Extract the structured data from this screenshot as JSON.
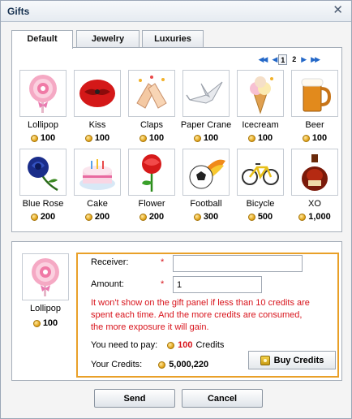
{
  "window": {
    "title": "Gifts"
  },
  "tabs": [
    {
      "label": "Default"
    },
    {
      "label": "Jewelry"
    },
    {
      "label": "Luxuries"
    }
  ],
  "pager": {
    "pages": [
      "1",
      "2"
    ],
    "current": "1"
  },
  "gifts": [
    {
      "name": "Lollipop",
      "price": "100",
      "icon": "lollipop-icon"
    },
    {
      "name": "Kiss",
      "price": "100",
      "icon": "kiss-icon"
    },
    {
      "name": "Claps",
      "price": "100",
      "icon": "claps-icon"
    },
    {
      "name": "Paper Crane",
      "price": "100",
      "icon": "paper-crane-icon"
    },
    {
      "name": "Icecream",
      "price": "100",
      "icon": "icecream-icon"
    },
    {
      "name": "Beer",
      "price": "100",
      "icon": "beer-icon"
    },
    {
      "name": "Blue Rose",
      "price": "200",
      "icon": "blue-rose-icon"
    },
    {
      "name": "Cake",
      "price": "200",
      "icon": "cake-icon"
    },
    {
      "name": "Flower",
      "price": "200",
      "icon": "flower-icon"
    },
    {
      "name": "Football",
      "price": "300",
      "icon": "football-icon"
    },
    {
      "name": "Bicycle",
      "price": "500",
      "icon": "bicycle-icon"
    },
    {
      "name": "XO",
      "price": "1,000",
      "icon": "xo-bottle-icon"
    }
  ],
  "selected": {
    "name": "Lollipop",
    "price": "100"
  },
  "form": {
    "receiver_label": "Receiver:",
    "receiver_value": "",
    "amount_label": "Amount:",
    "amount_value": "1",
    "required_mark": "*",
    "warning": "It won't show on the gift panel if less than 10 credits are spent each time. And the more credits are consumed, the more exposure it will gain.",
    "pay_label": "You need to pay:",
    "pay_amount": "100",
    "pay_unit": "Credits",
    "credits_label": "Your Credits:",
    "credits_amount": "5,000,220",
    "buy_label": "Buy Credits"
  },
  "footer": {
    "send_label": "Send",
    "cancel_label": "Cancel"
  },
  "colors": {
    "accent_border": "#e9a028",
    "required": "#d8141c",
    "coin": "#e4a820"
  }
}
